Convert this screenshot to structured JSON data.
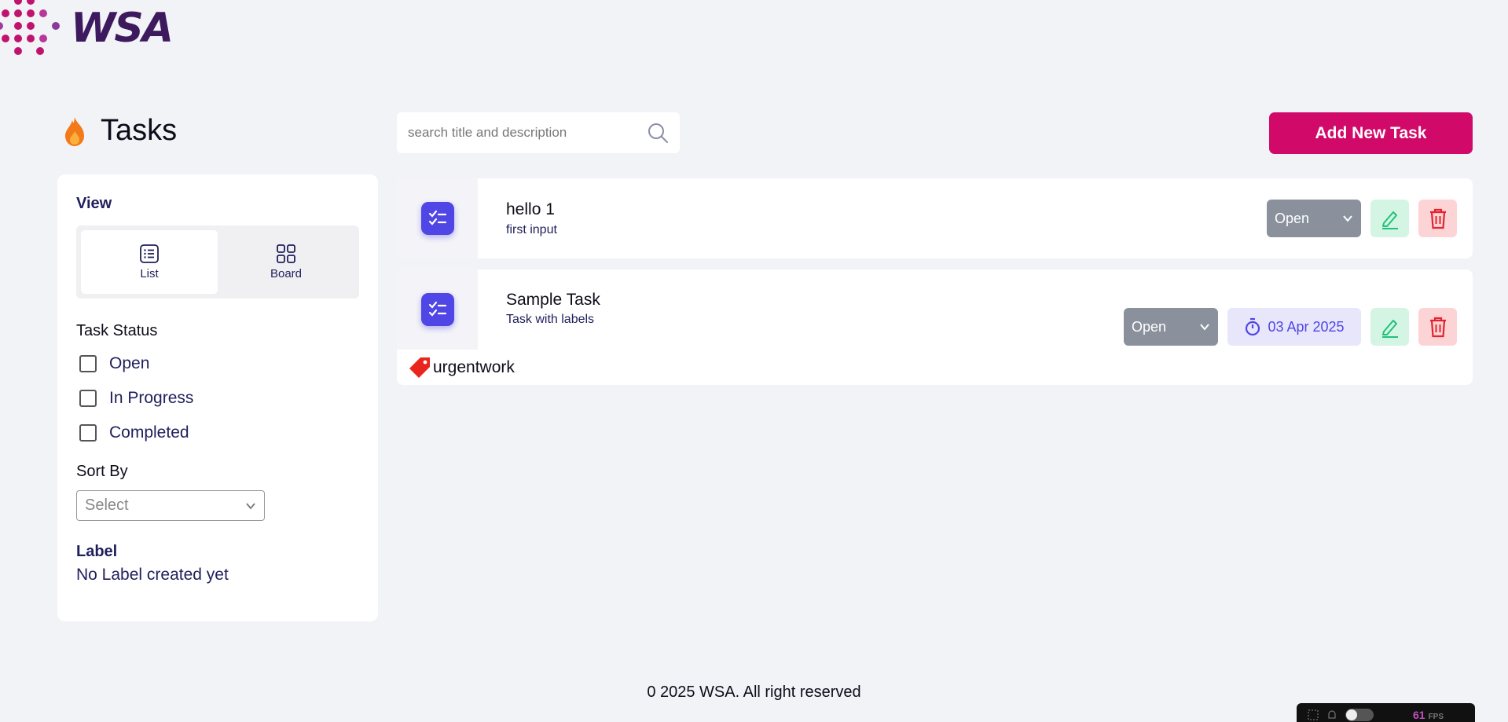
{
  "brand": {
    "wordmark": "WSA"
  },
  "header": {
    "title": "Tasks",
    "search_placeholder": "search title and description",
    "add_button": "Add New Task"
  },
  "sidebar": {
    "view_title": "View",
    "view_options": [
      {
        "label": "List",
        "icon": "list-icon",
        "active": true
      },
      {
        "label": "Board",
        "icon": "grid-icon",
        "active": false
      }
    ],
    "status_title": "Task Status",
    "statuses": [
      "Open",
      "In Progress",
      "Completed"
    ],
    "sort_title": "Sort By",
    "sort_placeholder": "Select",
    "label_title": "Label",
    "label_empty": "No Label created yet"
  },
  "tasks": [
    {
      "title": "hello 1",
      "description": "first input",
      "status": "Open"
    },
    {
      "title": "Sample Task",
      "description": "Task with labels",
      "status": "Open",
      "due_date": "03 Apr 2025",
      "label": "urgentwork"
    }
  ],
  "footer": {
    "text": "0 2025 WSA. All right reserved"
  },
  "devbar": {
    "fps": "61",
    "fps_unit": "FPS"
  },
  "colors": {
    "accent": "#d10a6a",
    "task_icon": "#5046e5",
    "status_bg": "#8a919c",
    "edit_bg": "#d4f5e4",
    "delete_bg": "#fcd4d6"
  }
}
